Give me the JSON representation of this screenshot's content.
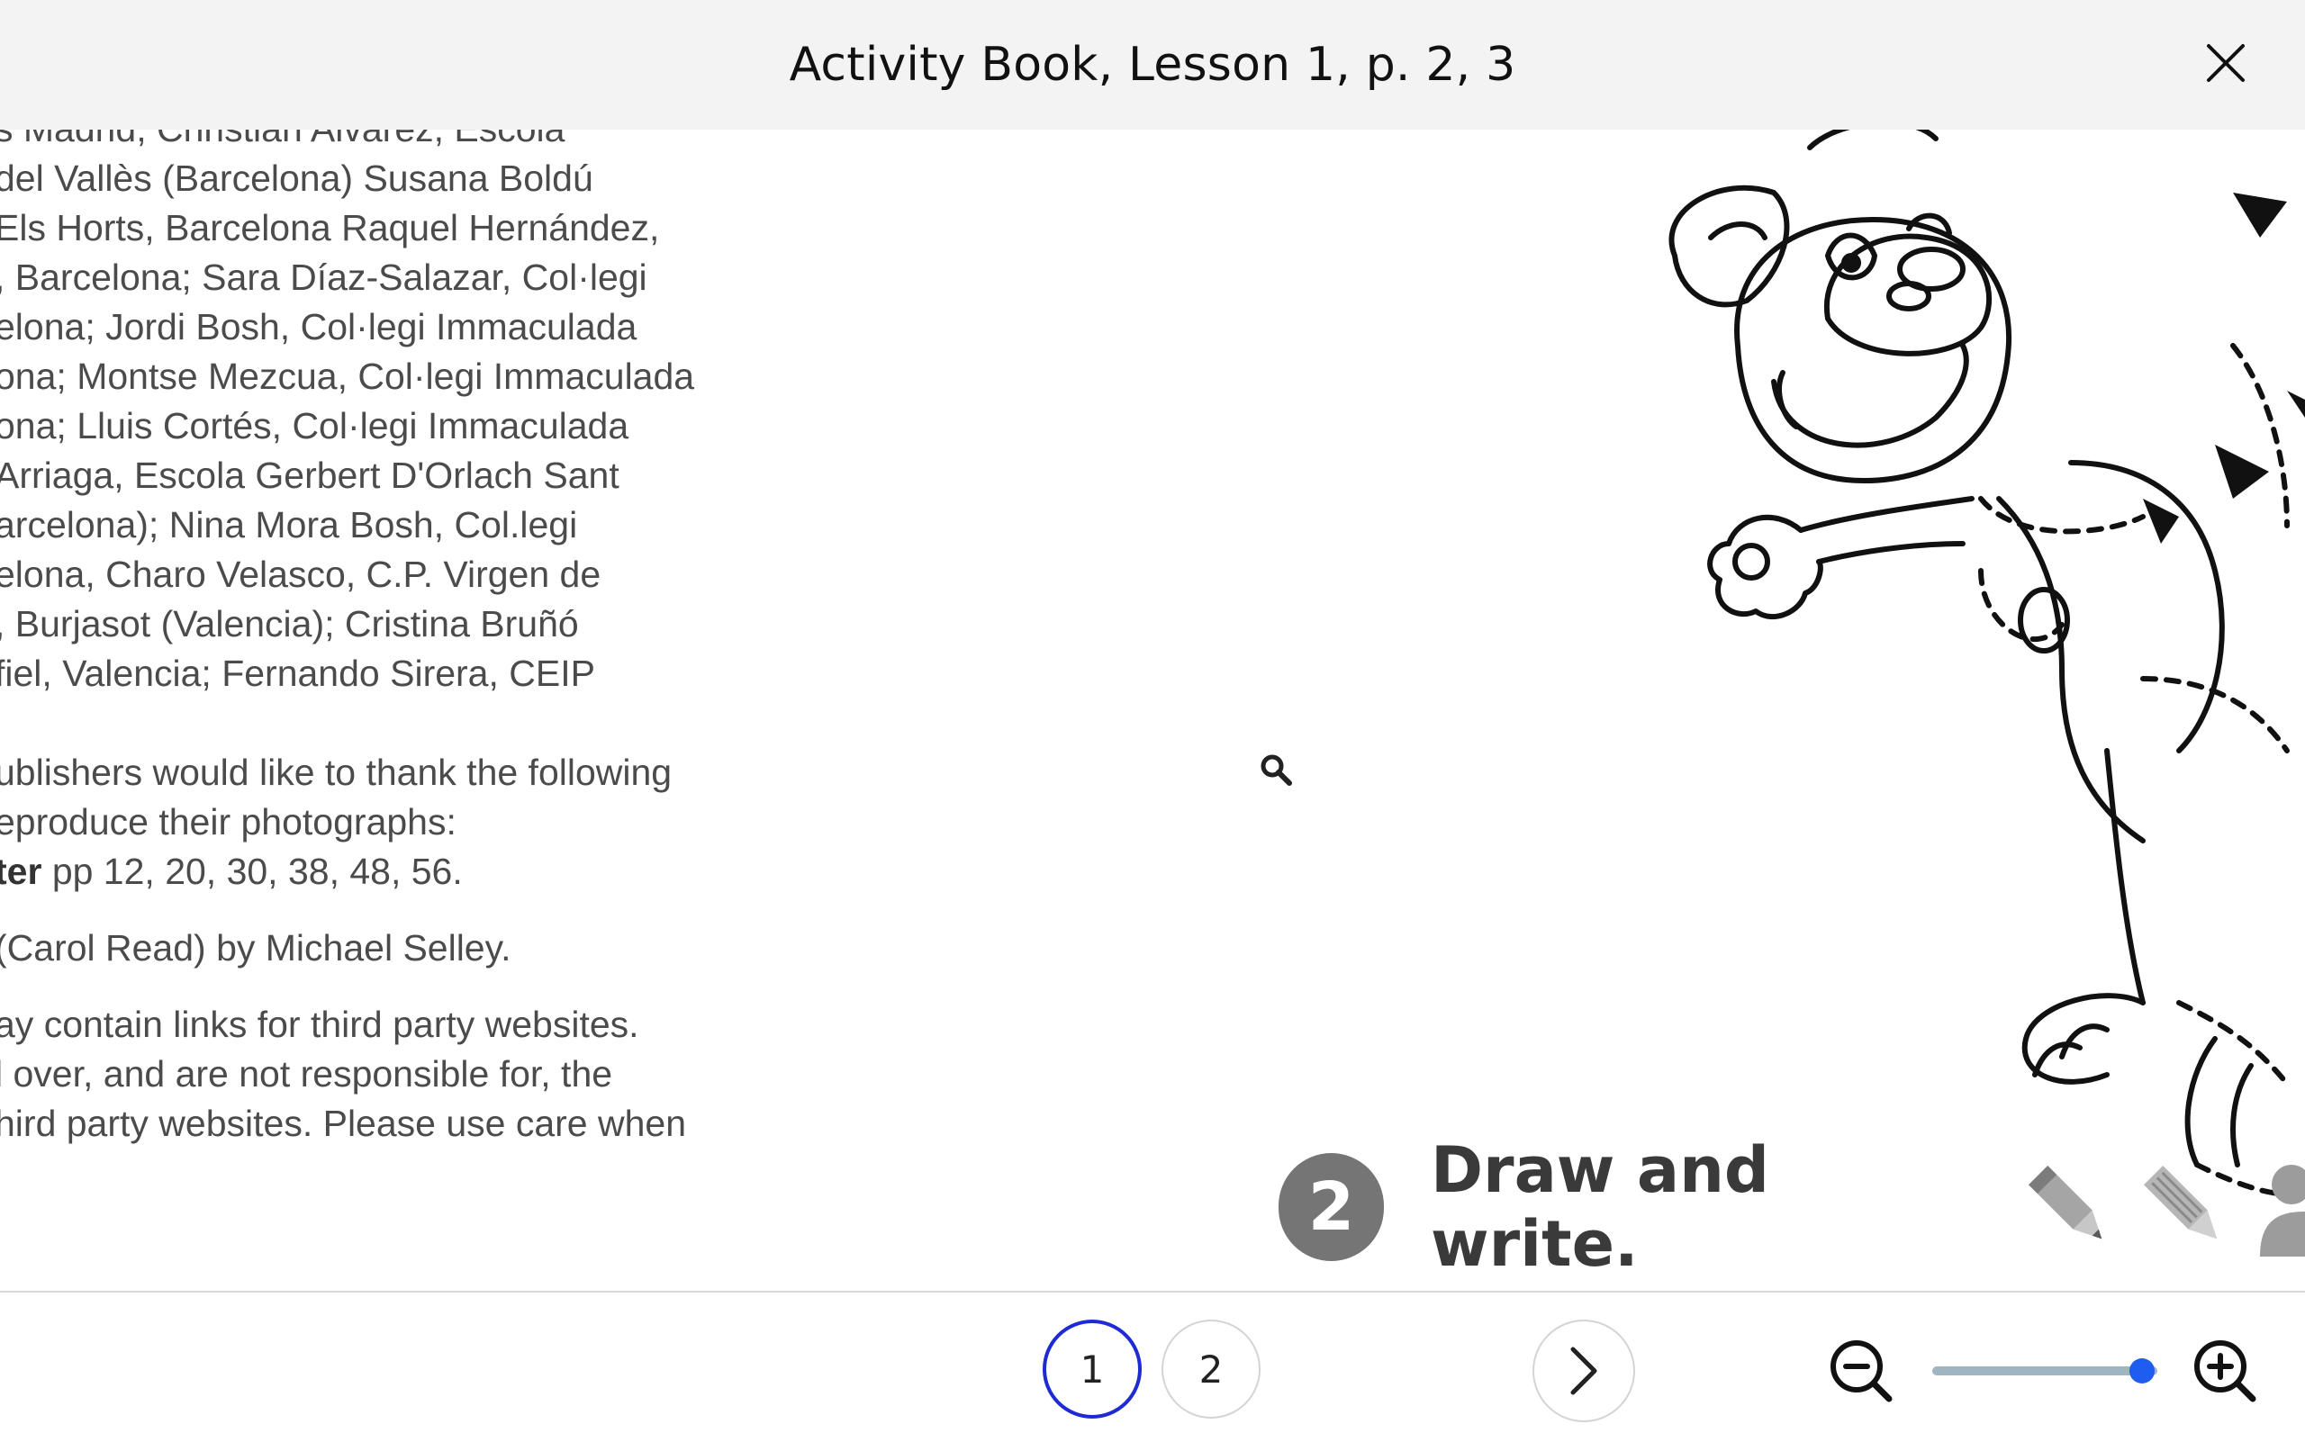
{
  "header": {
    "title": "Activity Book, Lesson 1, p. 2, 3",
    "close_icon": "close-icon"
  },
  "page": {
    "credits_lines": [
      "s Madrid; Christian Alvarez, Escola",
      " del Vallès (Barcelona) Susana Boldú",
      "Els Horts, Barcelona Raquel Hernández,",
      ", Barcelona; Sara Díaz-Salazar, Col·legi",
      "elona; Jordi Bosh, Col·legi Immaculada",
      "ona; Montse Mezcua, Col·legi Immaculada",
      "ona; Lluis Cortés, Col·legi Immaculada",
      "Arriaga, Escola Gerbert D'Orlach Sant",
      "arcelona); Nina Mora Bosh, Col.legi",
      "elona, Charo Velasco, C.P. Virgen de",
      ", Burjasot (Valencia); Cristina Bruñó",
      "fiel, Valencia; Fernando Sirera, CEIP"
    ],
    "publishers_lines": [
      "ublishers would like to thank the following",
      "eproduce their photographs:"
    ],
    "credit_bold": "ter",
    "credit_pages": " pp 12, 20, 30, 38, 48, 56.",
    "carol_line": " (Carol Read) by Michael Selley.",
    "disclaimer_lines": [
      "ay contain links for third party websites.",
      "l over, and are not responsible for, the",
      "hird party websites. Please use care when"
    ],
    "activity_number": "2",
    "activity_text": "Draw and write."
  },
  "footer": {
    "pages": [
      "1",
      "2"
    ],
    "active_page": "1",
    "zoom_level": 0.93
  }
}
